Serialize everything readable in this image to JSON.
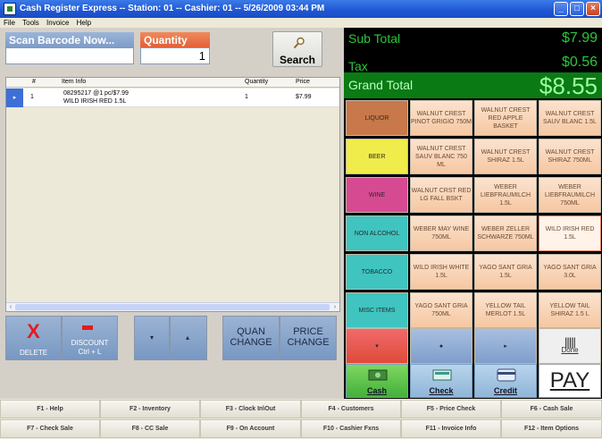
{
  "window": {
    "title": "Cash Register Express -- Station: 01 -- Cashier: 01 -- 5/26/2009 03:44 PM"
  },
  "menu": [
    "File",
    "Tools",
    "Invoice",
    "Help"
  ],
  "scan": {
    "label": "Scan Barcode Now...",
    "value": ""
  },
  "quantity": {
    "label": "Quantity",
    "value": "1"
  },
  "search": {
    "label": "Search",
    "icon": "magnifier-icon"
  },
  "grid": {
    "headers": [
      "#",
      "Item Info",
      "Quantity",
      "Price"
    ],
    "rows": [
      {
        "num": "1",
        "info1": "08295217 @1 pc/$7.99",
        "info2": "WILD IRISH RED 1.5L",
        "qty": "1",
        "price": "$7.99"
      }
    ]
  },
  "actions": {
    "delete": "DELETE",
    "discount1": "DISCOUNT",
    "discount2": "Ctrl + L",
    "quan1": "QUAN",
    "quan2": "CHANGE",
    "price1": "PRICE",
    "price2": "CHANGE"
  },
  "totals": {
    "subtotal_label": "Sub Total",
    "subtotal_value": "$7.99",
    "tax_label": "Tax",
    "tax_value": "$0.56",
    "grand_label": "Grand Total",
    "grand_value": "$8.55"
  },
  "categories": [
    {
      "label": "LIQUOR",
      "color": "#c8784a"
    },
    {
      "label": "BEER",
      "color": "#f0ec4c"
    },
    {
      "label": "WINE",
      "color": "#d64a92"
    },
    {
      "label": "NON ALCOHOL",
      "color": "#3fc4c0"
    },
    {
      "label": "TOBACCO",
      "color": "#3fc4c0"
    },
    {
      "label": "MISC ITEMS",
      "color": "#3fc4c0"
    }
  ],
  "items": [
    [
      "WALNUT CREST PINOT GRIGIO 750M",
      "WALNUT CREST RED APPLE BASKET",
      "WALNUT CREST SAUV BLANC 1.5L"
    ],
    [
      "WALNUT CREST SAUV BLANC 750 ML",
      "WALNUT CREST SHIRAZ 1.5L",
      "WALNUT CREST SHIRAZ 750ML"
    ],
    [
      "WALNUT CRST RED LG FALL BSKT",
      "WEBER LIEBFRAUMILCH 1.5L",
      "WEBER LIEBFRAUMILCH 750ML"
    ],
    [
      "WEBER MAY WINE 750ML",
      "WEBER ZELLER SCHWARZE 750ML",
      "WILD IRISH RED 1.5L"
    ],
    [
      "WILD IRISH WHITE 1.5L",
      "YAGO SANT GRIA 1.5L",
      "YAGO SANT GRIA 3.0L"
    ],
    [
      "YAGO SANT GRIA 750ML",
      "YELLOW TAIL MERLOT 1.5L",
      "YELLOW TAIL SHIRAZ 1.5 L"
    ]
  ],
  "done": {
    "label": "Done",
    "icon": "barcode-icon"
  },
  "tender": {
    "cash": "Cash",
    "check": "Check",
    "credit": "Credit",
    "pay": "PAY"
  },
  "fkeys": [
    "F1 - Help",
    "F2 - Inventory",
    "F3 - Clock In\\Out",
    "F4 - Customers",
    "F5 - Price Check",
    "F6 - Cash Sale",
    "F7 - Check Sale",
    "F8 - CC Sale",
    "F9 - On Account",
    "F10 - Cashier Fxns",
    "F11 - Invoice Info",
    "F12 - Item Options"
  ]
}
